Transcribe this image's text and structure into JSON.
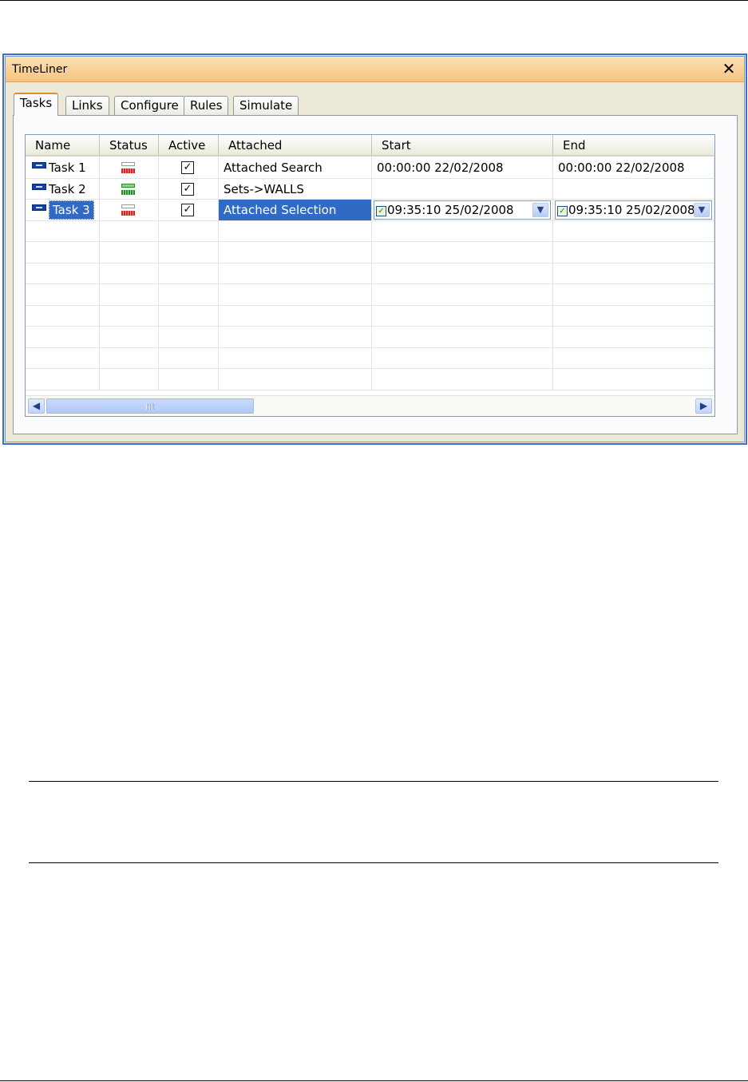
{
  "window": {
    "title": "TimeLiner",
    "close_glyph": "✕"
  },
  "tabs": [
    {
      "label": "Tasks",
      "active": true
    },
    {
      "label": "Links",
      "active": false
    },
    {
      "label": "Configure",
      "active": false
    },
    {
      "label": "Rules",
      "active": false
    },
    {
      "label": "Simulate",
      "active": false
    }
  ],
  "grid": {
    "columns": [
      "Name",
      "Status",
      "Active",
      "Attached",
      "Start",
      "End"
    ],
    "rows": [
      {
        "name": "Task 1",
        "status": "red",
        "active": true,
        "attached": "Attached Search",
        "start": "00:00:00 22/02/2008",
        "end": "00:00:00 22/02/2008"
      },
      {
        "name": "Task 2",
        "status": "green",
        "active": true,
        "attached": "Sets->WALLS",
        "start": "",
        "end": ""
      },
      {
        "name": "Task 3",
        "status": "red",
        "active": true,
        "attached": "Attached Selection",
        "start": "09:35:10 25/02/2008",
        "end": "09:35:10 25/02/2008",
        "selected": true
      }
    ],
    "check_glyph": "✓",
    "dropdown_glyph": "▼",
    "scroll_left_glyph": "◀",
    "scroll_right_glyph": "▶"
  },
  "colors": {
    "selection": "#316ac5",
    "titlebar": "#f7c47e",
    "window_border": "#3b6fd8",
    "status_red": "#e02020",
    "status_green": "#2a8a2a"
  }
}
